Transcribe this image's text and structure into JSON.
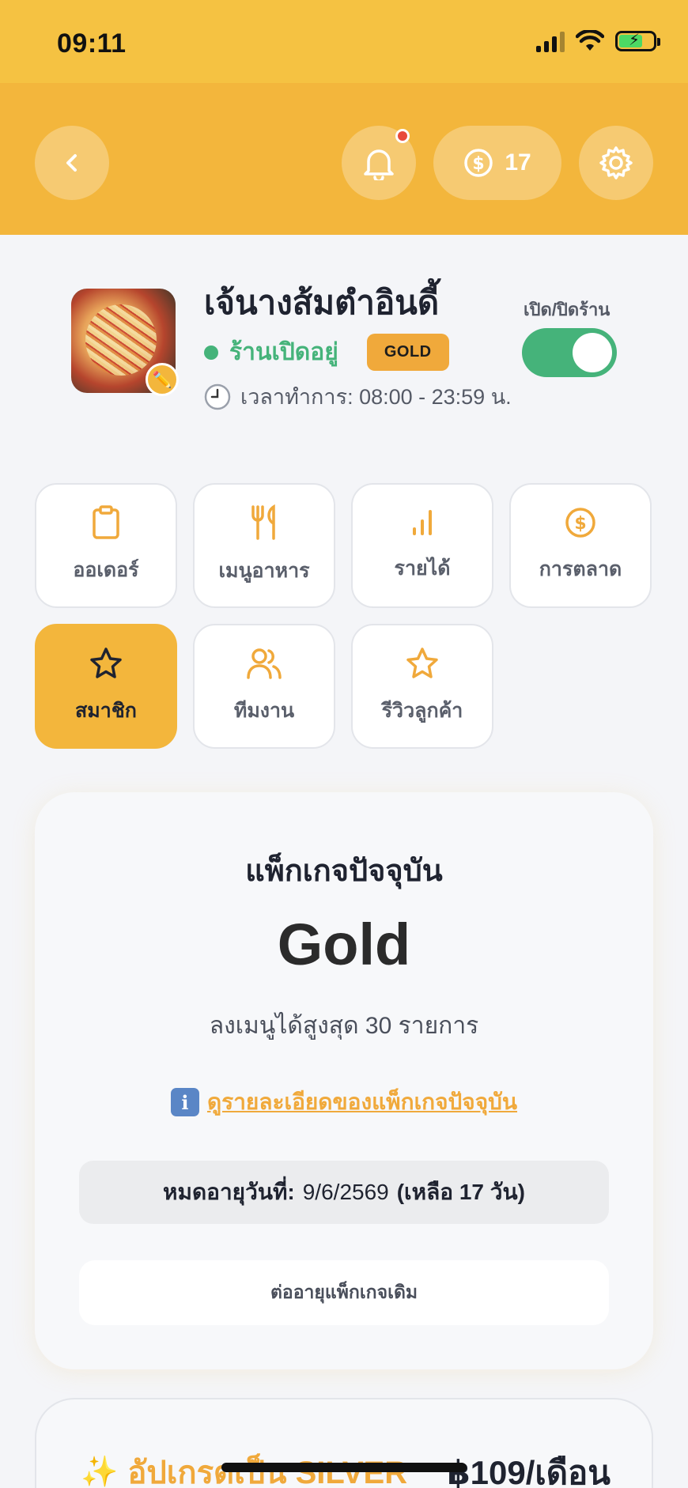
{
  "status_bar": {
    "time": "09:11"
  },
  "header": {
    "coin_count": "17"
  },
  "shop": {
    "name": "เจ้นางส้มตำอินดี้",
    "status_text": "ร้านเปิดอยู่",
    "tier_badge": "GOLD",
    "hours": "เวลาทำการ: 08:00 - 23:59 น.",
    "toggle_label": "เปิด/ปิดร้าน",
    "is_open": true
  },
  "menu": {
    "items": [
      {
        "label": "ออเดอร์",
        "icon": "clipboard-icon",
        "active": false
      },
      {
        "label": "เมนูอาหาร",
        "icon": "utensils-icon",
        "active": false
      },
      {
        "label": "รายได้",
        "icon": "bar-chart-icon",
        "active": false
      },
      {
        "label": "การตลาด",
        "icon": "coin-icon",
        "active": false
      },
      {
        "label": "สมาชิก",
        "icon": "star-icon",
        "active": true
      },
      {
        "label": "ทีมงาน",
        "icon": "users-icon",
        "active": false
      },
      {
        "label": "รีวิวลูกค้า",
        "icon": "star-outline-icon",
        "active": false
      }
    ]
  },
  "package": {
    "title": "แพ็กเกจปัจจุบัน",
    "name": "Gold",
    "limit": "ลงเมนูได้สูงสุด 30 รายการ",
    "details_link": "ดูรายละเอียดของแพ็กเกจปัจจุบัน",
    "info_icon": "i",
    "expiry_label": "หมดอายุวันที่:",
    "expiry_date": "9/6/2569",
    "remaining": "(เหลือ 17 วัน)",
    "renew_label": "ต่ออายุแพ็กเกจเดิม"
  },
  "upgrade": {
    "label": "อัปเกรดเป็น SILVER",
    "price": "฿109/เดือน",
    "icon": "sparkles-icon"
  },
  "colors": {
    "header": "#f3b63c",
    "status_bar": "#f5c242",
    "accent": "#f0a93b",
    "open_green": "#45b37a",
    "notification": "#e84a3b"
  }
}
